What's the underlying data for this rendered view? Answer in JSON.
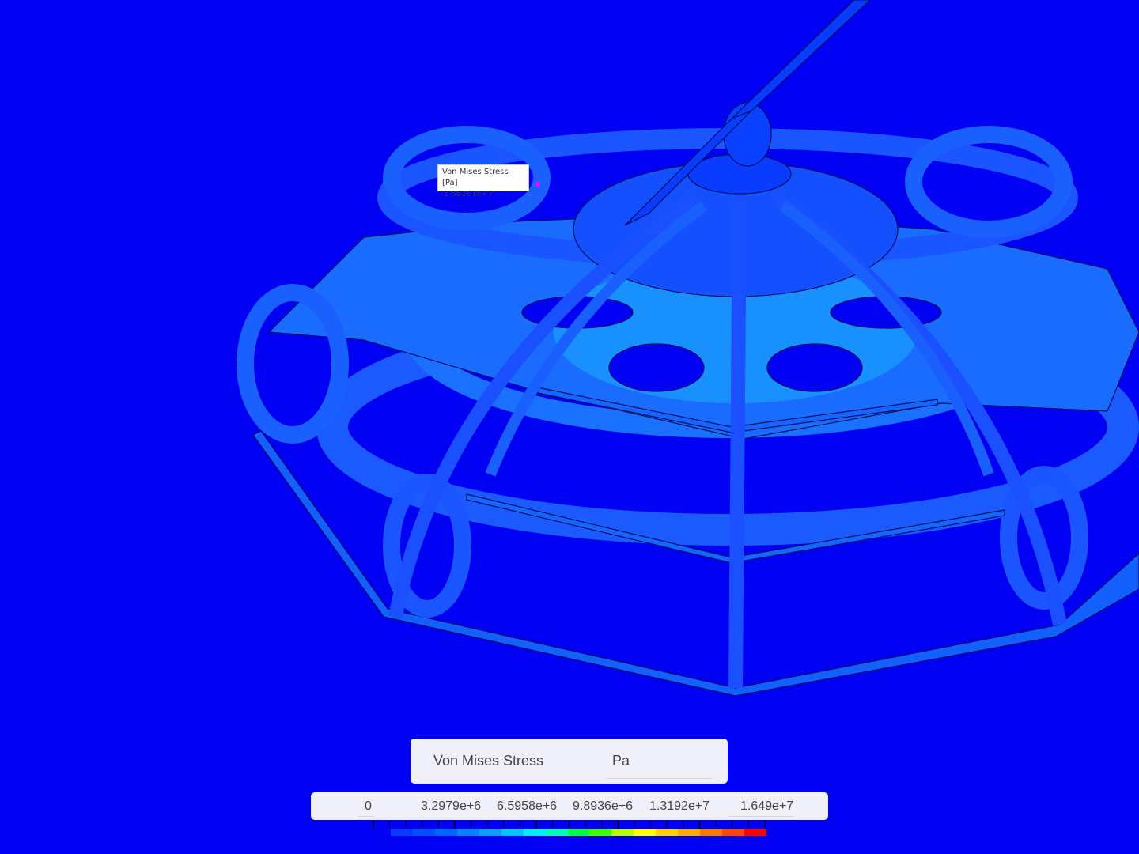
{
  "probe": {
    "label": "Von Mises Stress [Pa]",
    "value": "1.56261e+7"
  },
  "legend": {
    "title": "Von Mises Stress",
    "unit": "Pa",
    "tick_labels": [
      "0",
      "3.2979e+6",
      "6.5958e+6",
      "9.8936e+6",
      "1.3192e+7",
      "1.649e+7"
    ],
    "min": 0,
    "max": 16490000,
    "colors": [
      "#0a3cff",
      "#0050ff",
      "#0064ff",
      "#0a82ff",
      "#0aa0ff",
      "#00c8ff",
      "#00f0ff",
      "#00ffb4",
      "#00ff3c",
      "#3cff00",
      "#b4ff00",
      "#ffff00",
      "#ffd200",
      "#ffaa00",
      "#ff7800",
      "#ff4600",
      "#ff0000"
    ]
  },
  "colors": {
    "background": "#0000f2",
    "structure": "#0a32ff",
    "stress_low": "#1e6eff",
    "stress_mid": "#14b4ff",
    "marker": "#ff00ff"
  }
}
